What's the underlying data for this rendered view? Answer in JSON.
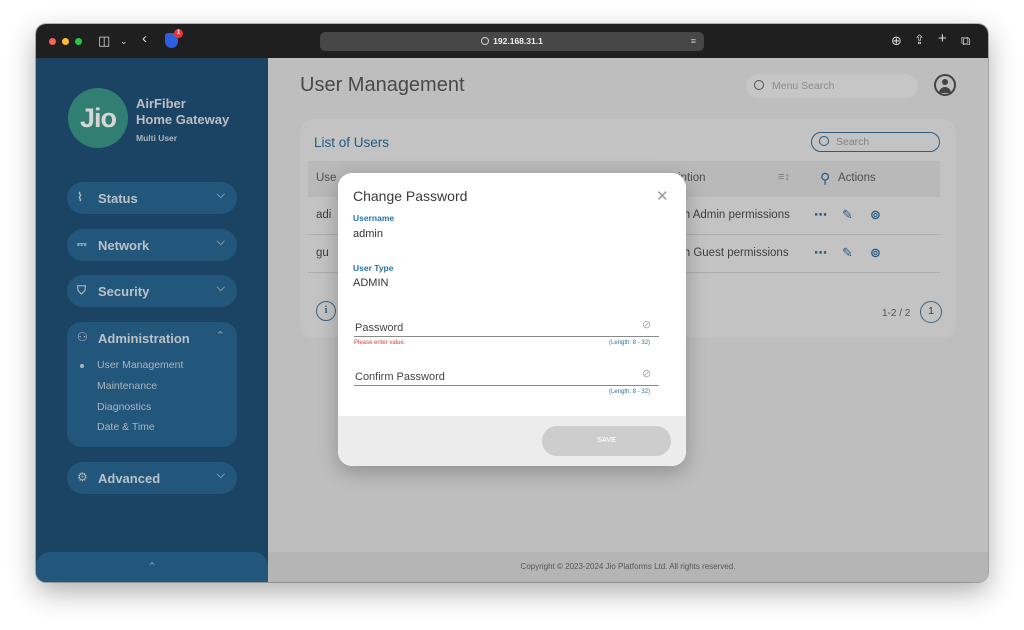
{
  "browser": {
    "url": "192.168.31.1",
    "badge": "1"
  },
  "sidebar": {
    "logo": "Jio",
    "brand_line1": "AirFiber",
    "brand_line2": "Home Gateway",
    "brand_line3": "Multi User",
    "nav": [
      {
        "label": "Status",
        "icon": "chart-icon"
      },
      {
        "label": "Network",
        "icon": "router-icon"
      },
      {
        "label": "Security",
        "icon": "shield-icon"
      },
      {
        "label": "Administration",
        "icon": "users-icon"
      },
      {
        "label": "Advanced",
        "icon": "gear-icon"
      }
    ],
    "admin_sub": [
      "User Management",
      "Maintenance",
      "Diagnostics",
      "Date & Time"
    ]
  },
  "header": {
    "title": "User Management",
    "menu_search_placeholder": "Menu Search"
  },
  "users_card": {
    "title": "List of Users",
    "search_placeholder": "Search",
    "columns": [
      "Use",
      "iption",
      "Actions"
    ],
    "rows": [
      {
        "name": "adi",
        "desc": "ith Admin permissions"
      },
      {
        "name": "gu",
        "desc": "ith Guest permissions"
      }
    ],
    "pager_text": "1-2 / 2",
    "page": "1"
  },
  "footer": {
    "copyright": "Copyright © 2023-2024 Jio Platforms Ltd. All rights reserved."
  },
  "modal": {
    "title": "Change Password",
    "username_label": "Username",
    "username_value": "admin",
    "usertype_label": "User Type",
    "usertype_value": "ADMIN",
    "password_label": "Password",
    "password_error": "Please enter value.",
    "password_hint": "(Length: 8 - 32)",
    "confirm_label": "Confirm Password",
    "confirm_hint": "(Length: 8 - 32)",
    "save_label": "SAVE"
  },
  "colors": {
    "sidebar_bg": "#12436b",
    "nav_pill": "#1a5a85",
    "accent": "#1e5e8c",
    "error": "#d24040"
  }
}
